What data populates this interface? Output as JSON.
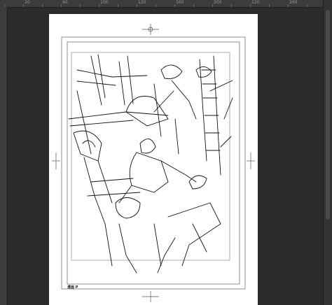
{
  "ruler": {
    "ticks": [
      "",
      "20",
      "",
      "60",
      "",
      "100",
      "",
      "120",
      "",
      "160",
      "",
      "200",
      "",
      "220",
      "",
      "260",
      ""
    ]
  },
  "page": {
    "label": "漫画 P",
    "paper_color": "#ffffff",
    "stroke_color": "#111111"
  },
  "colors": {
    "workspace": "#2b2b2b",
    "ruler": "#3c3c3c",
    "scrollbar": "#323232"
  }
}
